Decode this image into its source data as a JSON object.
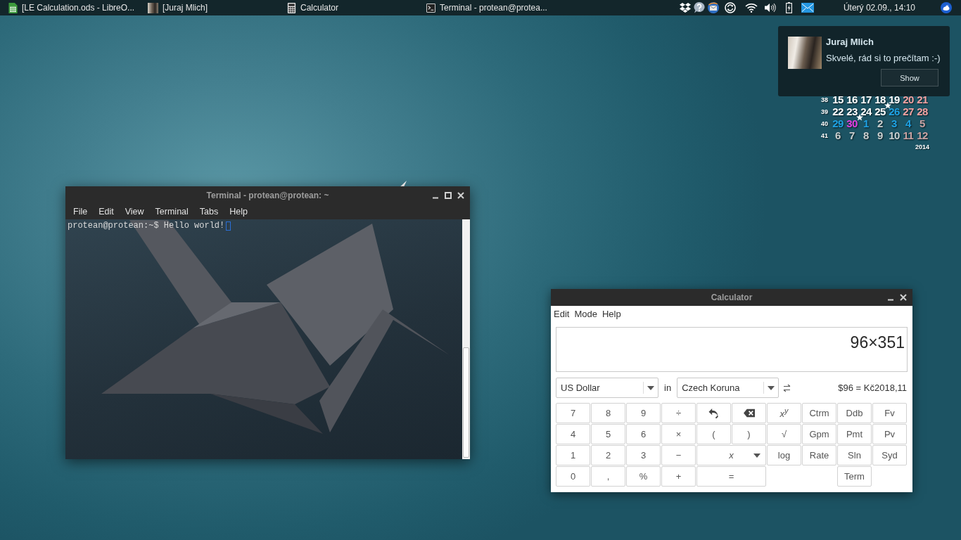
{
  "panel": {
    "tasks": [
      {
        "kind": "spreadsheet",
        "label": "[LE Calculation.ods - LibreO..."
      },
      {
        "kind": "photo",
        "label": "[Juraj Mlich]"
      },
      {
        "kind": "calculator",
        "label": "Calculator"
      },
      {
        "kind": "terminal",
        "label": "Terminal - protean@protea..."
      }
    ],
    "clock": "Úterý 02.09., 14:10"
  },
  "calendar": {
    "weeks": [
      {
        "number": "38",
        "days": [
          {
            "label": "15",
            "color": "#ffffff",
            "starred": false
          },
          {
            "label": "16",
            "color": "#ffffff",
            "starred": false
          },
          {
            "label": "17",
            "color": "#ffffff",
            "starred": false
          },
          {
            "label": "18",
            "color": "#ffffff",
            "starred": false
          },
          {
            "label": "19",
            "color": "#ffffff",
            "starred": false
          },
          {
            "label": "20",
            "color": "#f2a2a2",
            "starred": false
          },
          {
            "label": "21",
            "color": "#f2a2a2",
            "starred": false
          }
        ]
      },
      {
        "number": "39",
        "days": [
          {
            "label": "22",
            "color": "#ffffff",
            "starred": false
          },
          {
            "label": "23",
            "color": "#ffffff",
            "starred": false
          },
          {
            "label": "24",
            "color": "#ffffff",
            "starred": false
          },
          {
            "label": "25",
            "color": "#ffffff",
            "starred": true
          },
          {
            "label": "26",
            "color": "#1ea2e4",
            "starred": false
          },
          {
            "label": "27",
            "color": "#f2a2a2",
            "starred": false
          },
          {
            "label": "28",
            "color": "#f2a2a2",
            "starred": false
          }
        ]
      },
      {
        "number": "40",
        "days": [
          {
            "label": "29",
            "color": "#1ea2e4",
            "starred": false
          },
          {
            "label": "30",
            "color": "#e53fe5",
            "starred": true
          },
          {
            "label": "1",
            "color": "#1ea2e4",
            "starred": false
          },
          {
            "label": "2",
            "color": "#c9cfcf",
            "starred": false
          },
          {
            "label": "3",
            "color": "#1ea2e4",
            "starred": false
          },
          {
            "label": "4",
            "color": "#1ea2e4",
            "starred": false
          },
          {
            "label": "5",
            "color": "#c9a3a3",
            "starred": false
          }
        ]
      },
      {
        "number": "41",
        "days": [
          {
            "label": "6",
            "color": "#c9cfcf",
            "starred": false
          },
          {
            "label": "7",
            "color": "#c9cfcf",
            "starred": false
          },
          {
            "label": "8",
            "color": "#c9cfcf",
            "starred": false
          },
          {
            "label": "9",
            "color": "#c9cfcf",
            "starred": false
          },
          {
            "label": "10",
            "color": "#c9cfcf",
            "starred": false
          },
          {
            "label": "11",
            "color": "#c9a3a3",
            "starred": false
          },
          {
            "label": "12",
            "color": "#c9a3a3",
            "starred": false
          }
        ]
      }
    ],
    "year": "2014"
  },
  "notification": {
    "sender": "Juraj Mlich",
    "message": "Skvelé, rád si to prečítam :-)",
    "button": "Show"
  },
  "terminal": {
    "title": "Terminal - protean@protean: ~",
    "menu": [
      "File",
      "Edit",
      "View",
      "Terminal",
      "Tabs",
      "Help"
    ],
    "line": "protean@protean:~$ Hello world!"
  },
  "calculator": {
    "title": "Calculator",
    "menu": [
      "Edit",
      "Mode",
      "Help"
    ],
    "display": "96×351",
    "from_currency": "US Dollar",
    "in_label": "in",
    "to_currency": "Czech Koruna",
    "conversion": "$96 = Kč2018,11",
    "keys": [
      [
        {
          "kind": "key",
          "label": "7"
        },
        {
          "kind": "key",
          "label": "8"
        },
        {
          "kind": "key",
          "label": "9"
        },
        {
          "kind": "key",
          "label": "÷"
        },
        {
          "kind": "undo"
        },
        {
          "kind": "erase"
        },
        {
          "kind": "math",
          "label": "x$^{y}$"
        },
        {
          "kind": "key",
          "label": "Ctrm"
        },
        {
          "kind": "key",
          "label": "Ddb"
        },
        {
          "kind": "key",
          "label": "Fv"
        }
      ],
      [
        {
          "kind": "key",
          "label": "4"
        },
        {
          "kind": "key",
          "label": "5"
        },
        {
          "kind": "key",
          "label": "6"
        },
        {
          "kind": "key",
          "label": "×"
        },
        {
          "kind": "key",
          "label": "("
        },
        {
          "kind": "key",
          "label": ")"
        },
        {
          "kind": "key",
          "label": "√"
        },
        {
          "kind": "key",
          "label": "Gpm"
        },
        {
          "kind": "key",
          "label": "Pmt"
        },
        {
          "kind": "key",
          "label": "Pv"
        }
      ],
      [
        {
          "kind": "key",
          "label": "1"
        },
        {
          "kind": "key",
          "label": "2"
        },
        {
          "kind": "key",
          "label": "3"
        },
        {
          "kind": "key",
          "label": "−"
        },
        {
          "kind": "variable",
          "label": "x"
        },
        {
          "kind": "key",
          "label": "log"
        },
        {
          "kind": "key",
          "label": "Rate"
        },
        {
          "kind": "key",
          "label": "Sln"
        },
        {
          "kind": "key",
          "label": "Syd"
        }
      ],
      [
        {
          "kind": "key",
          "label": "0"
        },
        {
          "kind": "key",
          "label": ","
        },
        {
          "kind": "key",
          "label": "%"
        },
        {
          "kind": "key",
          "label": "+"
        },
        {
          "kind": "wide",
          "label": "="
        },
        {
          "kind": "gap"
        },
        {
          "kind": "gap"
        },
        {
          "kind": "key",
          "label": "Term"
        }
      ]
    ]
  }
}
